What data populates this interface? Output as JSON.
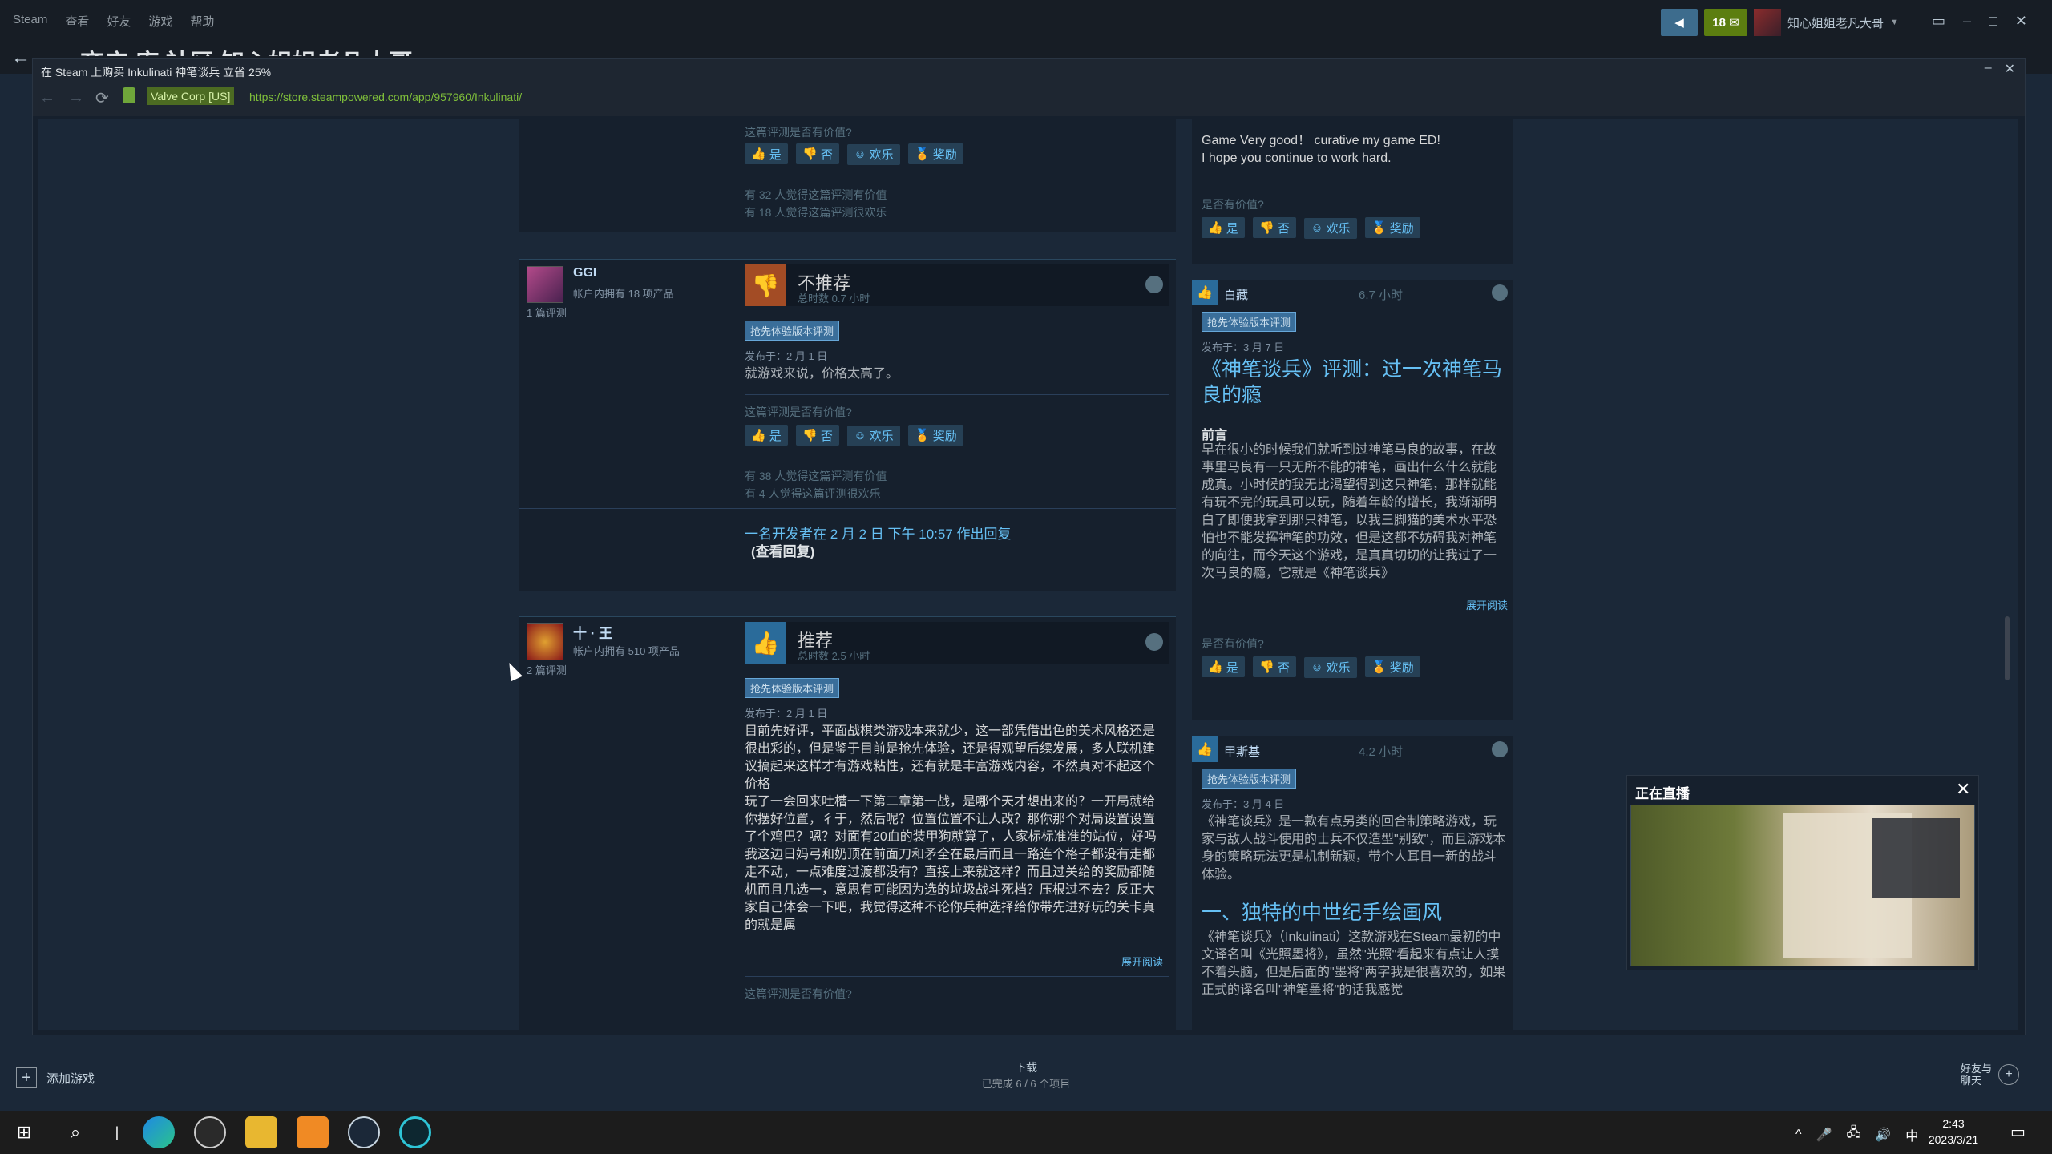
{
  "client": {
    "menu": [
      "Steam",
      "查看",
      "好友",
      "游戏",
      "帮助"
    ],
    "notif_count": "18",
    "username": "知心姐姐老凡大哥",
    "page_title_partial": "商店 库 社区 知心姐姐老凡大哥"
  },
  "window": {
    "title": "在 Steam 上购买 Inkulinati 神笔谈兵 立省 25%",
    "cert": "Valve Corp [US]",
    "url": "https://store.steampowered.com/app/957960/Inkulinati/"
  },
  "reviews": [
    {
      "helpful_q": "这篇评测是否有价值?",
      "buttons": [
        "是",
        "否",
        "欢乐",
        "奖励"
      ],
      "stats": [
        "有 32 人觉得这篇评测有价值",
        "有 18 人觉得这篇评测很欢乐"
      ]
    },
    {
      "user": "GGI",
      "owned": "帐户内拥有 18 项产品",
      "review_count": "1 篇评测",
      "verdict": "不推荐",
      "hours": "总时数 0.7 小时",
      "tag": "抢先体验版本评测",
      "posted": "发布于：2 月 1 日",
      "body": "就游戏来说，价格太高了。",
      "helpful_q": "这篇评测是否有价值?",
      "buttons": [
        "是",
        "否",
        "欢乐",
        "奖励"
      ],
      "stats": [
        "有 38 人觉得这篇评测有价值",
        "有 4 人觉得这篇评测很欢乐"
      ],
      "dev_reply": "一名开发者在 2 月 2 日 下午 10:57 作出回复",
      "view_reply": "(查看回复)"
    },
    {
      "user": "十 · 王",
      "owned": "帐户内拥有 510 项产品",
      "review_count": "2 篇评测",
      "verdict": "推荐",
      "hours": "总时数 2.5 小时",
      "tag": "抢先体验版本评测",
      "posted": "发布于：2 月 1 日",
      "body": "目前先好评，平面战棋类游戏本来就少，这一部凭借出色的美术风格还是很出彩的，但是鉴于目前是抢先体验，还是得观望后续发展，多人联机建议搞起来这样才有游戏粘性，还有就是丰富游戏内容，不然真对不起这个价格\n玩了一会回来吐槽一下第二章第一战，是哪个天才想出来的？一开局就给你摆好位置，彳于，然后呢？位置位置不让人改？那你那个对局设置设置了个鸡巴？嗯？对面有20血的装甲狗就算了，人家标标准准的站位，好吗我这边日妈弓和奶顶在前面刀和矛全在最后而且一路连个格子都没有走都走不动，一点难度过渡都没有？直接上来就这样？而且过关给的奖励都随机而且几选一，意思有可能因为选的垃圾战斗死档？压根过不去？反正大家自己体会一下吧，我觉得这种不论你兵种选择给你带先进好玩的关卡真的就是属",
      "read_more": "展开阅读",
      "helpful_q": "这篇评测是否有价值?"
    }
  ],
  "side_reviews": [
    {
      "body": "Game Very good！ curative my game ED!\nI hope you continue to work hard.",
      "helpful_q": "是否有价值?",
      "buttons": [
        "是",
        "否",
        "欢乐",
        "奖励"
      ]
    },
    {
      "user": "白藏",
      "hours": "6.7 小时",
      "tag": "抢先体验版本评测",
      "posted": "发布于：3 月 7 日",
      "headline": "《神笔谈兵》评测：过一次神笔马良的瘾",
      "section": "前言",
      "body": "早在很小的时候我们就听到过神笔马良的故事，在故事里马良有一只无所不能的神笔，画出什么什么就能成真。小时候的我无比渴望得到这只神笔，那样就能有玩不完的玩具可以玩，随着年龄的增长，我渐渐明白了即便我拿到那只神笔，以我三脚猫的美术水平恐怕也不能发挥神笔的功效，但是这都不妨碍我对神笔的向往，而今天这个游戏，是真真切切的让我过了一次马良的瘾，它就是《神笔谈兵》",
      "read_more": "展开阅读",
      "helpful_q": "是否有价值?",
      "buttons": [
        "是",
        "否",
        "欢乐",
        "奖励"
      ]
    },
    {
      "user": "甲斯基",
      "hours": "4.2 小时",
      "tag": "抢先体验版本评测",
      "posted": "发布于：3 月 4 日",
      "body": "《神笔谈兵》是一款有点另类的回合制策略游戏，玩家与敌人战斗使用的士兵不仅造型\"别致\"，而且游戏本身的策略玩法更是机制新颖，带个人耳目一新的战斗体验。",
      "heading": "一、独特的中世纪手绘画风",
      "body2": "《神笔谈兵》（Inkulinati）这款游戏在Steam最初的中文译名叫《光照墨将》，虽然\"光照\"看起来有点让人摸不着头脑，但是后面的\"墨将\"两字我是很喜欢的，如果正式的译名叫\"神笔墨将\"的话我感觉"
    }
  ],
  "live": {
    "title": "正在直播"
  },
  "bottom": {
    "add_game": "添加游戏",
    "downloads": "下载",
    "downloads_status": "已完成 6 / 6 个项目",
    "friends": "好友与\n聊天"
  },
  "taskbar": {
    "time": "2:43",
    "date": "2023/3/21",
    "ime": "中"
  },
  "colors": {
    "link": "#66c0f4",
    "tag_bg": "#3a6e9a",
    "notif_green": "#5c7e10",
    "cert_green": "#4c6b22"
  }
}
